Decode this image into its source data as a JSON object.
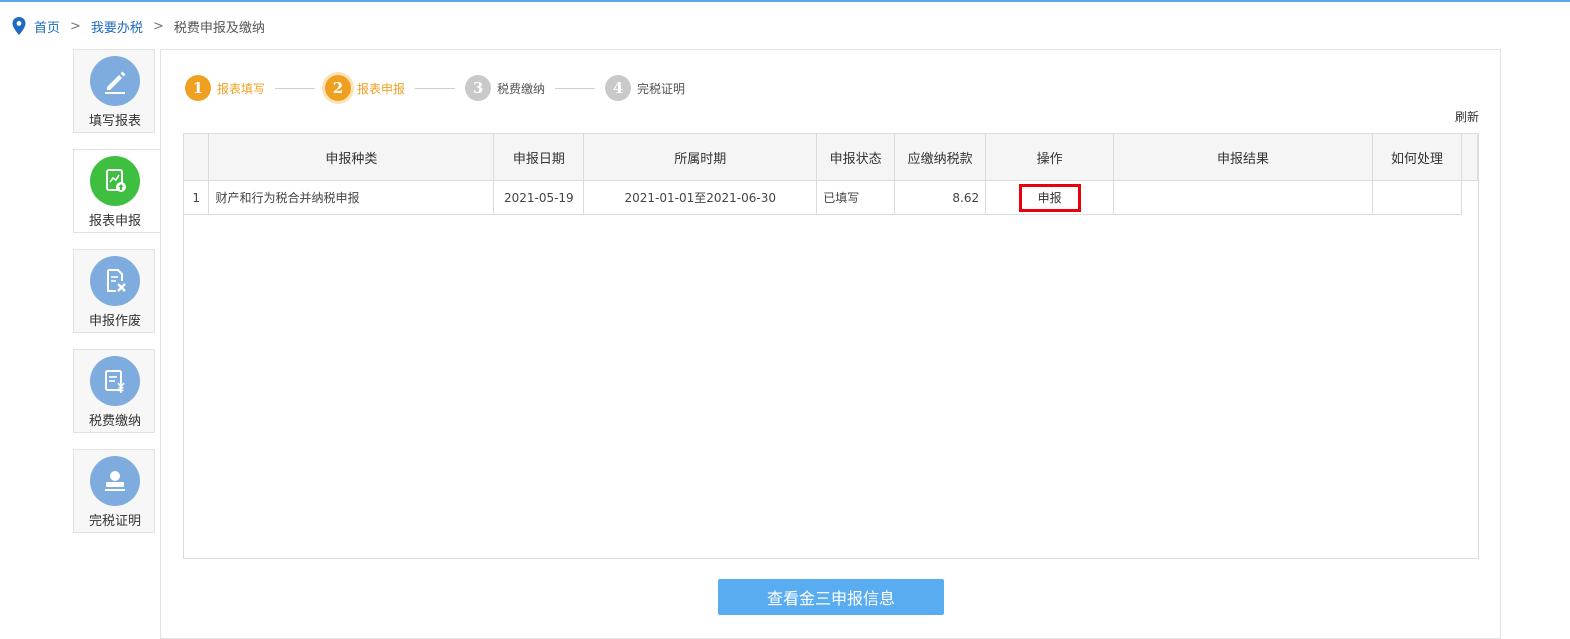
{
  "breadcrumb": {
    "home": "首页",
    "sep1": ">",
    "level2": "我要办税",
    "sep2": ">",
    "current": "税费申报及缴纳"
  },
  "sidebar": {
    "items": [
      {
        "label": "填写报表",
        "icon": "edit-pencil-icon"
      },
      {
        "label": "报表申报",
        "icon": "report-upload-icon"
      },
      {
        "label": "申报作废",
        "icon": "document-cancel-icon"
      },
      {
        "label": "税费缴纳",
        "icon": "tax-payment-icon"
      },
      {
        "label": "完税证明",
        "icon": "stamp-certificate-icon"
      }
    ],
    "active_index": 1
  },
  "steps": [
    {
      "num": "1",
      "label": "报表填写",
      "state": "done"
    },
    {
      "num": "2",
      "label": "报表申报",
      "state": "current"
    },
    {
      "num": "3",
      "label": "税费缴纳",
      "state": "pending"
    },
    {
      "num": "4",
      "label": "完税证明",
      "state": "pending"
    }
  ],
  "refresh_label": "刷新",
  "table": {
    "headers": [
      "",
      "申报种类",
      "申报日期",
      "所属时期",
      "申报状态",
      "应缴纳税款",
      "操作",
      "申报结果",
      "如何处理"
    ],
    "rows": [
      {
        "index": "1",
        "type": "财产和行为税合并纳税申报",
        "date": "2021-05-19",
        "period": "2021-01-01至2021-06-30",
        "status": "已填写",
        "amount": "8.62",
        "action": "申报",
        "result": "",
        "handle": ""
      }
    ]
  },
  "view_button": "查看金三申报信息",
  "colors": {
    "accent": "#5aacf1",
    "step_active": "#f0a020",
    "highlight_border": "#e8000b",
    "active_icon": "#3fbf3f",
    "icon_bg": "#7facde"
  }
}
